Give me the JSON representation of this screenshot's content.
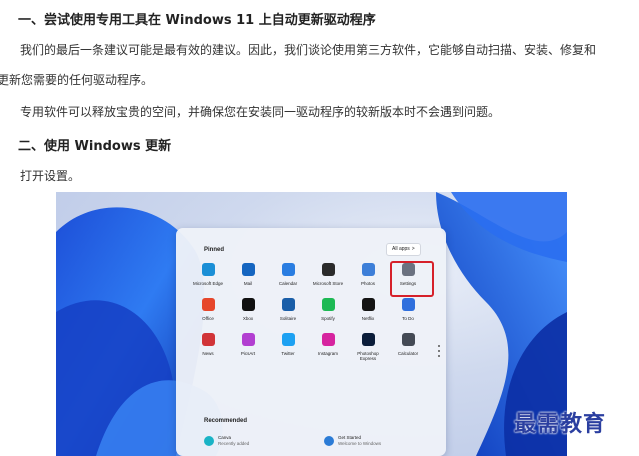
{
  "article": {
    "heading_1": "一、尝试使用专用工具在 Windows 11 上自动更新驱动程序",
    "para_1a": "我们的最后一条建议可能是最有效的建议。因此，我们谈论使用第三方软件，它能够自动扫描、安装、修复和",
    "para_1b": "更新您需要的任何驱动程序。",
    "para_2": "专用软件可以释放宝贵的空间，并确保您在安装同一驱动程序的较新版本时不会遇到问题。",
    "heading_2": "二、使用 Windows 更新",
    "para_3": "打开设置。"
  },
  "start_menu": {
    "pinned_label": "Pinned",
    "all_apps_label": "All apps",
    "all_apps_chevron": ">",
    "apps": [
      {
        "label": "Microsoft Edge",
        "icon": "edge-icon",
        "color": "#1b8fd6"
      },
      {
        "label": "Mail",
        "icon": "mail-icon",
        "color": "#1565c0"
      },
      {
        "label": "Calendar",
        "icon": "calendar-icon",
        "color": "#2a7de1"
      },
      {
        "label": "Microsoft Store",
        "icon": "store-icon",
        "color": "#2b2b2b"
      },
      {
        "label": "Photos",
        "icon": "photos-icon",
        "color": "#3d7fd8"
      },
      {
        "label": "Settings",
        "icon": "settings-gear-icon",
        "color": "#6b7280"
      },
      {
        "label": "Office",
        "icon": "office-icon",
        "color": "#e6462b"
      },
      {
        "label": "Xbox",
        "icon": "xbox-icon",
        "color": "#111111"
      },
      {
        "label": "Solitaire",
        "icon": "solitaire-icon",
        "color": "#1a5ea8"
      },
      {
        "label": "Spotify",
        "icon": "spotify-icon",
        "color": "#1db954"
      },
      {
        "label": "Netflix",
        "icon": "netflix-icon",
        "color": "#141414"
      },
      {
        "label": "To Do",
        "icon": "todo-icon",
        "color": "#2f6fdd"
      },
      {
        "label": "News",
        "icon": "news-icon",
        "color": "#d13438"
      },
      {
        "label": "PicsArt",
        "icon": "picsart-icon",
        "color": "#b23fd1"
      },
      {
        "label": "Twitter",
        "icon": "twitter-icon",
        "color": "#1da1f2"
      },
      {
        "label": "Instagram",
        "icon": "instagram-icon",
        "color": "#d6249f"
      },
      {
        "label": "Photoshop\nExpress",
        "icon": "photoshop-icon",
        "color": "#0b1d3a"
      },
      {
        "label": "Calculator",
        "icon": "calculator-icon",
        "color": "#444a55"
      }
    ],
    "recommended_label": "Recommended",
    "recommended": [
      {
        "title": "Canva",
        "subtitle": "Recently added",
        "icon": "canva-icon",
        "color": "#19b3c6"
      },
      {
        "title": "Get Started",
        "subtitle": "Welcome to Windows",
        "icon": "get-started-icon",
        "color": "#2b7bd6"
      }
    ],
    "highlight_color": "#d6212a"
  },
  "watermark": "最需教育"
}
